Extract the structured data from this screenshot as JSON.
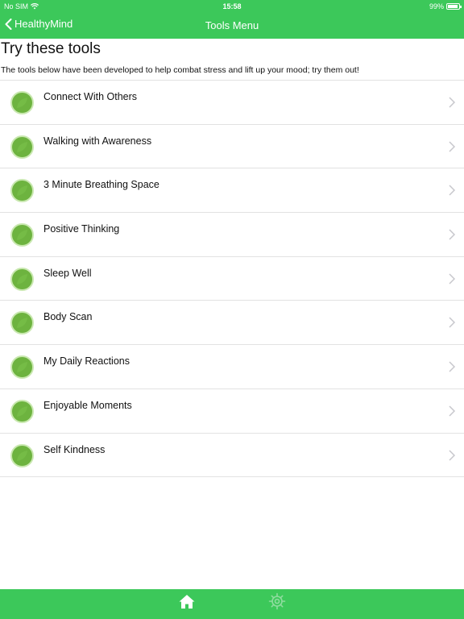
{
  "status_bar": {
    "carrier": "No SIM",
    "time": "15:58",
    "battery": "99%"
  },
  "nav": {
    "back_label": "HealthyMind",
    "title": "Tools Menu"
  },
  "header": {
    "title": "Try these tools",
    "subtitle": "The tools below have been developed to help combat stress and lift up your mood; try them out!"
  },
  "tools": [
    {
      "label": "Connect With Others"
    },
    {
      "label": "Walking with Awareness"
    },
    {
      "label": "3 Minute Breathing Space"
    },
    {
      "label": "Positive Thinking"
    },
    {
      "label": "Sleep Well"
    },
    {
      "label": "Body Scan"
    },
    {
      "label": "My Daily Reactions"
    },
    {
      "label": "Enjoyable Moments"
    },
    {
      "label": "Self Kindness"
    }
  ],
  "tab_bar": {
    "items": [
      {
        "icon": "home-icon",
        "active": true
      },
      {
        "icon": "gear-icon",
        "active": false
      }
    ]
  },
  "colors": {
    "brand_green": "#3cc85a",
    "icon_green": "#6db33f",
    "divider": "#e2e2e2",
    "chevron": "#c7c7cc",
    "inactive_tab": "#8fdc9f"
  }
}
